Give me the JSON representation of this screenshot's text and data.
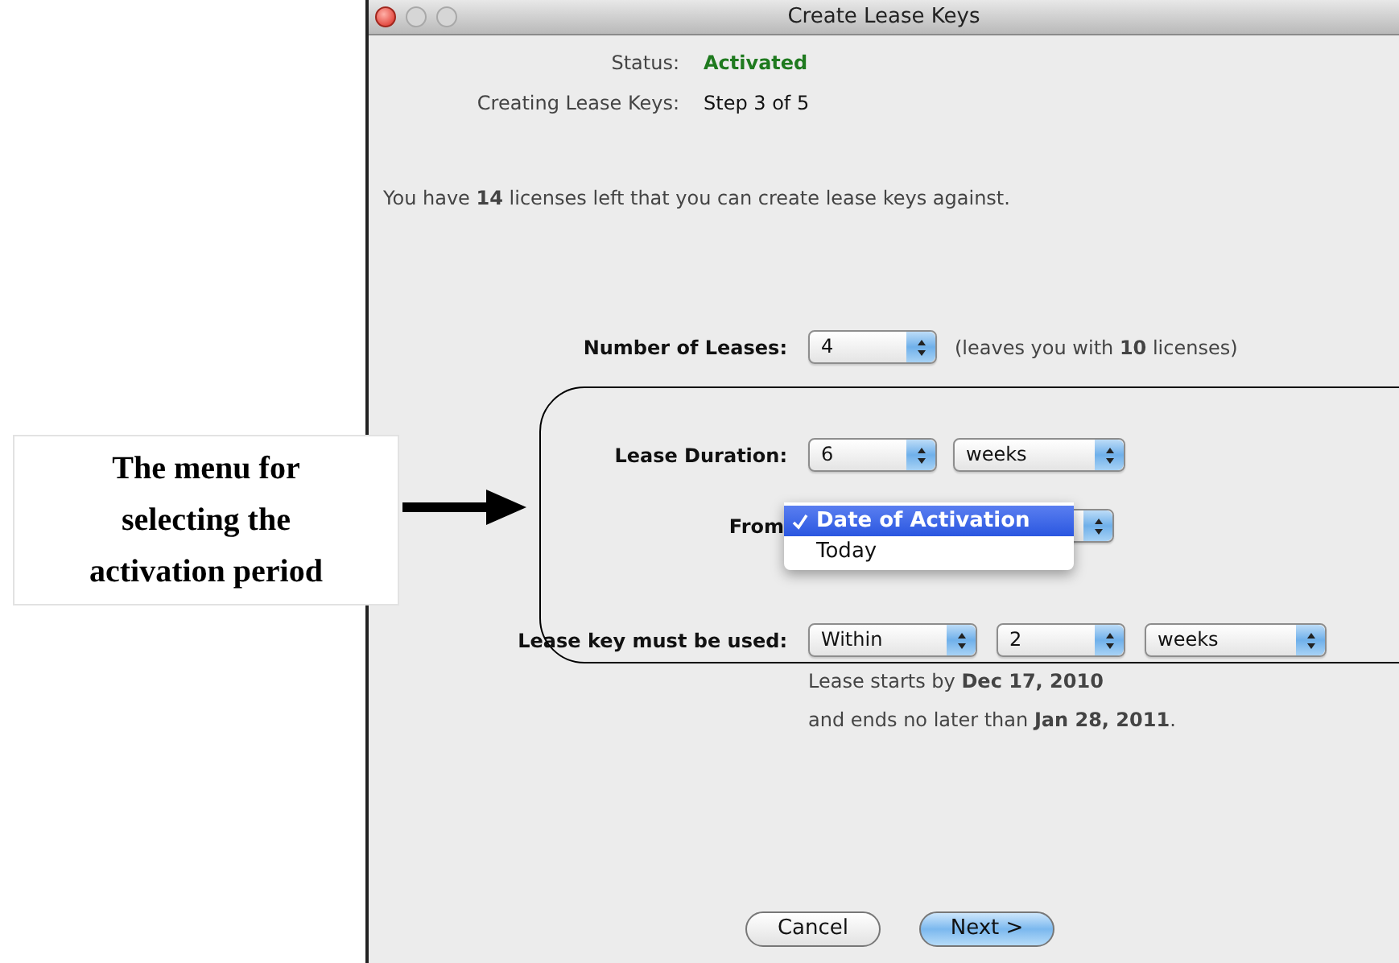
{
  "window": {
    "title": "Create Lease Keys"
  },
  "status": {
    "label": "Status:",
    "value": "Activated"
  },
  "progress": {
    "label": "Creating Lease Keys:",
    "value": "Step 3 of 5"
  },
  "summary": "You have **14** licenses left that you can create lease keys against.",
  "number_of_leases": {
    "label": "Number of Leases:",
    "value": "4",
    "note": "(leaves you with **10** licenses)"
  },
  "lease_duration": {
    "label": "Lease Duration:",
    "amount": "6",
    "unit": "weeks"
  },
  "from": {
    "label": "From",
    "menu": [
      {
        "label": "Date of Activation",
        "selected": true
      },
      {
        "label": "Today",
        "selected": false
      }
    ]
  },
  "must_be_used": {
    "label": "Lease key must be used:",
    "fields": [
      "Within",
      "2",
      "weeks"
    ]
  },
  "dates": [
    "Lease starts by **Dec 17, 2010**",
    "and ends no later than **Jan 28, 2011**."
  ],
  "buttons": [
    {
      "label": "Cancel",
      "default": false
    },
    {
      "label": "Next >",
      "default": true
    }
  ],
  "annotation": {
    "text": "The menu for selecting the activation period"
  }
}
